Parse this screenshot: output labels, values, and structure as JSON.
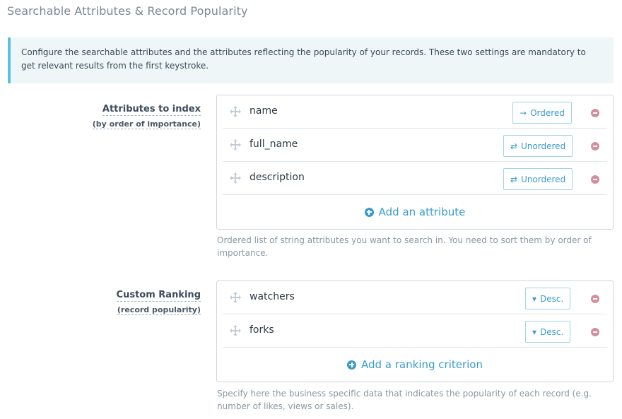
{
  "page": {
    "title": "Searchable Attributes & Record Popularity"
  },
  "callout": {
    "text": "Configure the searchable attributes and the attributes reflecting the popularity of your records. These two settings are mandatory to get relevant results from the first keystroke."
  },
  "attributes_section": {
    "label": "Attributes to index",
    "sublabel": "(by order of importance)",
    "items": [
      {
        "name": "name",
        "order_label": "Ordered",
        "order_icon": "arrow-right-icon"
      },
      {
        "name": "full_name",
        "order_label": "Unordered",
        "order_icon": "exchange-icon"
      },
      {
        "name": "description",
        "order_label": "Unordered",
        "order_icon": "exchange-icon"
      }
    ],
    "add_label": "Add an attribute",
    "help": "Ordered list of string attributes you want to search in. You need to sort them by order of importance."
  },
  "ranking_section": {
    "label": "Custom Ranking",
    "sublabel": "(record popularity)",
    "items": [
      {
        "name": "watchers",
        "order_label": "Desc.",
        "order_icon": "caret-down-icon"
      },
      {
        "name": "forks",
        "order_label": "Desc.",
        "order_icon": "caret-down-icon"
      }
    ],
    "add_label": "Add a ranking criterion",
    "help": "Specify here the business specific data that indicates the popularity of each record (e.g. number of likes, views or sales)."
  },
  "colors": {
    "accent": "#3a9ccc",
    "remove": "#d2909b",
    "callout_border": "#5bc0de",
    "callout_bg": "#eef6f8"
  }
}
